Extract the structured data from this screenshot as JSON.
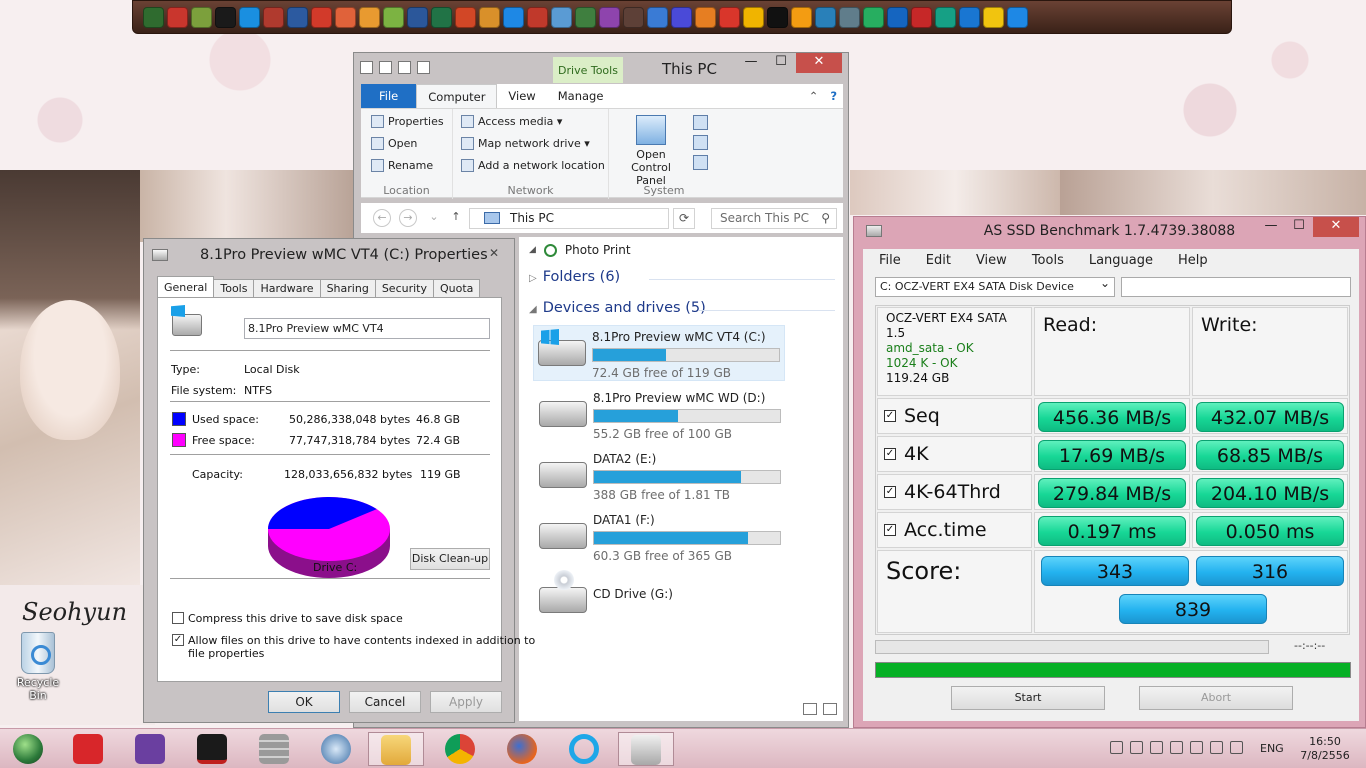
{
  "wallpaper": {
    "signature": "Seohyun"
  },
  "desktop": {
    "recycle_bin": "Recycle Bin"
  },
  "dock_icon_colors": [
    "#2f6b2f",
    "#c9362d",
    "#7ca03c",
    "#1a1a1a",
    "#1a8fe0",
    "#b03a2e",
    "#2c5aa0",
    "#d23a2a",
    "#e0623a",
    "#e89a30",
    "#7cb342",
    "#2b579a",
    "#217346",
    "#d24726",
    "#d9902a",
    "#1e88e5",
    "#c0392b",
    "#5a9bd4",
    "#3f7f3f",
    "#8e44ad",
    "#5d4037",
    "#3a7bd5",
    "#4a4ad8",
    "#e67e22",
    "#d9362b",
    "#f0b400",
    "#111111",
    "#f39c12",
    "#2980b9",
    "#607d8b",
    "#27ae60",
    "#1565c0",
    "#c62828",
    "#16a085",
    "#1976d2",
    "#f1c40f",
    "#1e88e5"
  ],
  "explorer": {
    "title": "This PC",
    "context_tab": "Drive Tools",
    "tabs": {
      "file": "File",
      "computer": "Computer",
      "view": "View",
      "manage": "Manage"
    },
    "ribbon": {
      "location": {
        "properties": "Properties",
        "open": "Open",
        "rename": "Rename",
        "label": "Location"
      },
      "network": {
        "access_media": "Access media ▾",
        "map_drive": "Map network drive ▾",
        "add_location": "Add a network location",
        "label": "Network"
      },
      "system": {
        "control_panel": "Open Control Panel",
        "label": "System"
      }
    },
    "address": "This PC",
    "search_placeholder": "Search This PC",
    "photo_print": "Photo Print",
    "folders_header": "Folders (6)",
    "devices_header": "Devices and drives (5)",
    "drives": [
      {
        "name": "8.1Pro Preview wMC VT4 (C:)",
        "free": "72.4 GB free of 119 GB",
        "used_fraction": 0.39
      },
      {
        "name": "8.1Pro Preview wMC WD (D:)",
        "free": "55.2 GB free of 100 GB",
        "used_fraction": 0.45
      },
      {
        "name": "DATA2 (E:)",
        "free": "388 GB free of 1.81 TB",
        "used_fraction": 0.79
      },
      {
        "name": "DATA1 (F:)",
        "free": "60.3 GB free of 365 GB",
        "used_fraction": 0.83
      },
      {
        "name": "CD Drive (G:)"
      }
    ]
  },
  "properties": {
    "title": "8.1Pro Preview wMC VT4 (C:) Properties",
    "tabs": [
      "General",
      "Tools",
      "Hardware",
      "Sharing",
      "Security",
      "Quota"
    ],
    "volume_name": "8.1Pro Preview wMC VT4",
    "type_label": "Type:",
    "type_value": "Local Disk",
    "fs_label": "File system:",
    "fs_value": "NTFS",
    "used_label": "Used space:",
    "used_bytes": "50,286,338,048 bytes",
    "used_size": "46.8 GB",
    "free_label": "Free space:",
    "free_bytes": "77,747,318,784 bytes",
    "free_size": "72.4 GB",
    "capacity_label": "Capacity:",
    "capacity_bytes": "128,033,656,832 bytes",
    "capacity_size": "119 GB",
    "used_color": "#0000ff",
    "free_color": "#ff00ff",
    "used_fraction": 0.393,
    "drive_label": "Drive C:",
    "cleanup": "Disk Clean-up",
    "compress": "Compress this drive to save disk space",
    "index_line1": "Allow files on this drive to have contents indexed in addition to",
    "index_line2": "file properties",
    "ok": "OK",
    "cancel": "Cancel",
    "apply": "Apply"
  },
  "asssd": {
    "title": "AS SSD Benchmark 1.7.4739.38088",
    "menu": [
      "File",
      "Edit",
      "View",
      "Tools",
      "Language",
      "Help"
    ],
    "drive_select": "C: OCZ-VERT EX4 SATA Disk Device",
    "info": {
      "model": "OCZ-VERT EX4 SATA",
      "fw": "1.5",
      "driver": "amd_sata - OK",
      "align": "1024 K - OK",
      "size": "119.24 GB"
    },
    "read_header": "Read:",
    "write_header": "Write:",
    "rows": [
      {
        "label": "Seq",
        "read": "456.36 MB/s",
        "write": "432.07 MB/s"
      },
      {
        "label": "4K",
        "read": "17.69 MB/s",
        "write": "68.85 MB/s"
      },
      {
        "label": "4K-64Thrd",
        "read": "279.84 MB/s",
        "write": "204.10 MB/s"
      },
      {
        "label": "Acc.time",
        "read": "0.197 ms",
        "write": "0.050 ms"
      }
    ],
    "score_label": "Score:",
    "score_read": "343",
    "score_write": "316",
    "score_total": "839",
    "elapsed": "--:--:--",
    "start": "Start",
    "abort": "Abort"
  },
  "taskbar": {
    "apps": [
      "start-orb",
      "flash",
      "cpu-z",
      "amd-fx",
      "firewall",
      "tool",
      "file-explorer",
      "chrome",
      "firefox",
      "internet-explorer",
      "as-ssd"
    ],
    "lang": "ENG",
    "time": "16:50",
    "date": "7/8/2556"
  }
}
